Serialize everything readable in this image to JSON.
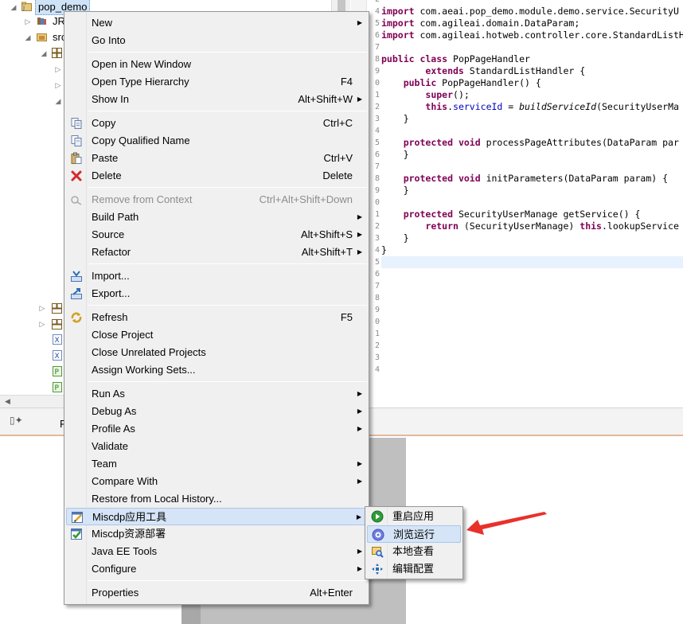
{
  "project_explorer": {
    "root_label": "pop_demo",
    "items": [
      {
        "label": "JR"
      },
      {
        "label": "src"
      }
    ]
  },
  "editor": {
    "line_numbers": [
      "2",
      "4",
      "5",
      "6",
      "7",
      "8",
      "9",
      "0",
      "1",
      "2",
      "3",
      "4",
      "5",
      "6",
      "7",
      "8",
      "9",
      "0",
      "1",
      "2",
      "3",
      "4",
      "5",
      "6",
      "7",
      "8",
      "9",
      "0",
      "1",
      "2",
      "3",
      "4"
    ],
    "lines": [
      [
        {
          "t": "kw",
          "v": "import"
        },
        {
          "t": "",
          "v": " com.aeai.pop_demo.module.demo.service.SecurityU"
        }
      ],
      [
        {
          "t": "kw",
          "v": "import"
        },
        {
          "t": "",
          "v": " com.agileai.domain.DataParam;"
        }
      ],
      [
        {
          "t": "kw",
          "v": "import"
        },
        {
          "t": "",
          "v": " com.agileai.hotweb.controller.core.StandardListH"
        }
      ],
      [],
      [
        {
          "t": "kw",
          "v": "public class"
        },
        {
          "t": "",
          "v": " PopPageHandler"
        }
      ],
      [
        {
          "t": "",
          "v": "        "
        },
        {
          "t": "kw",
          "v": "extends"
        },
        {
          "t": "",
          "v": " StandardListHandler {"
        }
      ],
      [
        {
          "t": "",
          "v": "    "
        },
        {
          "t": "kw",
          "v": "public"
        },
        {
          "t": "",
          "v": " PopPageHandler() {"
        }
      ],
      [
        {
          "t": "",
          "v": "        "
        },
        {
          "t": "kw",
          "v": "super"
        },
        {
          "t": "",
          "v": "();"
        }
      ],
      [
        {
          "t": "",
          "v": "        "
        },
        {
          "t": "kw",
          "v": "this"
        },
        {
          "t": "",
          "v": "."
        },
        {
          "t": "fld",
          "v": "serviceId"
        },
        {
          "t": "",
          "v": " = "
        },
        {
          "t": "mth",
          "v": "buildServiceId"
        },
        {
          "t": "",
          "v": "(SecurityUserMa"
        }
      ],
      [
        {
          "t": "",
          "v": "    }"
        }
      ],
      [],
      [
        {
          "t": "",
          "v": "    "
        },
        {
          "t": "kw",
          "v": "protected void"
        },
        {
          "t": "",
          "v": " processPageAttributes(DataParam par"
        }
      ],
      [
        {
          "t": "",
          "v": "    }"
        }
      ],
      [],
      [
        {
          "t": "",
          "v": "    "
        },
        {
          "t": "kw",
          "v": "protected void"
        },
        {
          "t": "",
          "v": " initParameters(DataParam param) {"
        }
      ],
      [
        {
          "t": "",
          "v": "    }"
        }
      ],
      [],
      [
        {
          "t": "",
          "v": "    "
        },
        {
          "t": "kw",
          "v": "protected"
        },
        {
          "t": "",
          "v": " SecurityUserManage getService() {"
        }
      ],
      [
        {
          "t": "",
          "v": "        "
        },
        {
          "t": "kw",
          "v": "return"
        },
        {
          "t": "",
          "v": " (SecurityUserManage) "
        },
        {
          "t": "kw",
          "v": "this"
        },
        {
          "t": "",
          "v": ".lookupService"
        }
      ],
      [
        {
          "t": "",
          "v": "    }"
        }
      ],
      [
        {
          "t": "",
          "v": "}"
        }
      ]
    ]
  },
  "bottom_panel": {
    "tab_fragment": "P"
  },
  "context_menu": {
    "items": [
      {
        "label": "New",
        "mnemonic": "w",
        "shortcut": "",
        "arrow": true,
        "icon": "",
        "group": 0
      },
      {
        "label": "Go Into",
        "shortcut": "",
        "arrow": false,
        "icon": "",
        "group": 0
      },
      {
        "label": "Open in New Window",
        "shortcut": "",
        "arrow": false,
        "icon": "",
        "group": 1
      },
      {
        "label": "Open Type Hierarchy",
        "shortcut": "F4",
        "arrow": false,
        "icon": "",
        "group": 1
      },
      {
        "label": "Show In",
        "shortcut": "Alt+Shift+W",
        "arrow": true,
        "icon": "",
        "group": 1
      },
      {
        "label": "Copy",
        "shortcut": "Ctrl+C",
        "arrow": false,
        "icon": "copy-icon",
        "group": 2
      },
      {
        "label": "Copy Qualified Name",
        "shortcut": "",
        "arrow": false,
        "icon": "copy-qualified-icon",
        "group": 2
      },
      {
        "label": "Paste",
        "shortcut": "Ctrl+V",
        "arrow": false,
        "icon": "paste-icon",
        "group": 2
      },
      {
        "label": "Delete",
        "shortcut": "Delete",
        "arrow": false,
        "icon": "delete-icon",
        "group": 2
      },
      {
        "label": "Remove from Context",
        "shortcut": "Ctrl+Alt+Shift+Down",
        "arrow": false,
        "icon": "remove-context-icon",
        "group": 3,
        "disabled": true
      },
      {
        "label": "Build Path",
        "shortcut": "",
        "arrow": true,
        "icon": "",
        "group": 3
      },
      {
        "label": "Source",
        "shortcut": "Alt+Shift+S",
        "arrow": true,
        "icon": "",
        "group": 3
      },
      {
        "label": "Refactor",
        "shortcut": "Alt+Shift+T",
        "arrow": true,
        "icon": "",
        "group": 3
      },
      {
        "label": "Import...",
        "shortcut": "",
        "arrow": false,
        "icon": "import-icon",
        "group": 4
      },
      {
        "label": "Export...",
        "shortcut": "",
        "arrow": false,
        "icon": "export-icon",
        "group": 4
      },
      {
        "label": "Refresh",
        "shortcut": "F5",
        "arrow": false,
        "icon": "refresh-icon",
        "group": 5
      },
      {
        "label": "Close Project",
        "shortcut": "",
        "arrow": false,
        "icon": "",
        "group": 5
      },
      {
        "label": "Close Unrelated Projects",
        "shortcut": "",
        "arrow": false,
        "icon": "",
        "group": 5
      },
      {
        "label": "Assign Working Sets...",
        "shortcut": "",
        "arrow": false,
        "icon": "",
        "group": 5
      },
      {
        "label": "Run As",
        "shortcut": "",
        "arrow": true,
        "icon": "",
        "group": 6
      },
      {
        "label": "Debug As",
        "shortcut": "",
        "arrow": true,
        "icon": "",
        "group": 6
      },
      {
        "label": "Profile As",
        "shortcut": "",
        "arrow": true,
        "icon": "",
        "group": 6
      },
      {
        "label": "Validate",
        "shortcut": "",
        "arrow": false,
        "icon": "",
        "group": 6
      },
      {
        "label": "Team",
        "shortcut": "",
        "arrow": true,
        "icon": "",
        "group": 6
      },
      {
        "label": "Compare With",
        "shortcut": "",
        "arrow": true,
        "icon": "",
        "group": 6
      },
      {
        "label": "Restore from Local History...",
        "shortcut": "",
        "arrow": false,
        "icon": "",
        "group": 6
      },
      {
        "label": "Miscdp应用工具",
        "shortcut": "",
        "arrow": true,
        "icon": "miscdp-tool-icon",
        "group": 6,
        "highlighted": true
      },
      {
        "label": "Miscdp资源部署",
        "shortcut": "",
        "arrow": false,
        "icon": "miscdp-deploy-icon",
        "group": 6
      },
      {
        "label": "Java EE Tools",
        "shortcut": "",
        "arrow": true,
        "icon": "",
        "group": 6
      },
      {
        "label": "Configure",
        "shortcut": "",
        "arrow": true,
        "icon": "",
        "group": 6
      },
      {
        "label": "Properties",
        "shortcut": "Alt+Enter",
        "arrow": false,
        "icon": "",
        "group": 7
      }
    ]
  },
  "submenu": {
    "items": [
      {
        "label": "重启应用",
        "icon": "restart-icon"
      },
      {
        "label": "浏览运行",
        "icon": "browse-run-icon",
        "highlighted": true
      },
      {
        "label": "本地查看",
        "icon": "local-view-icon"
      },
      {
        "label": "编辑配置",
        "icon": "edit-config-icon"
      }
    ]
  },
  "colors": {
    "menu_bg": "#f0f0f0",
    "menu_highlight": "#d5e4f7",
    "arrow_red": "#e8312a",
    "keyword": "#7f0055",
    "field": "#0000c0"
  }
}
